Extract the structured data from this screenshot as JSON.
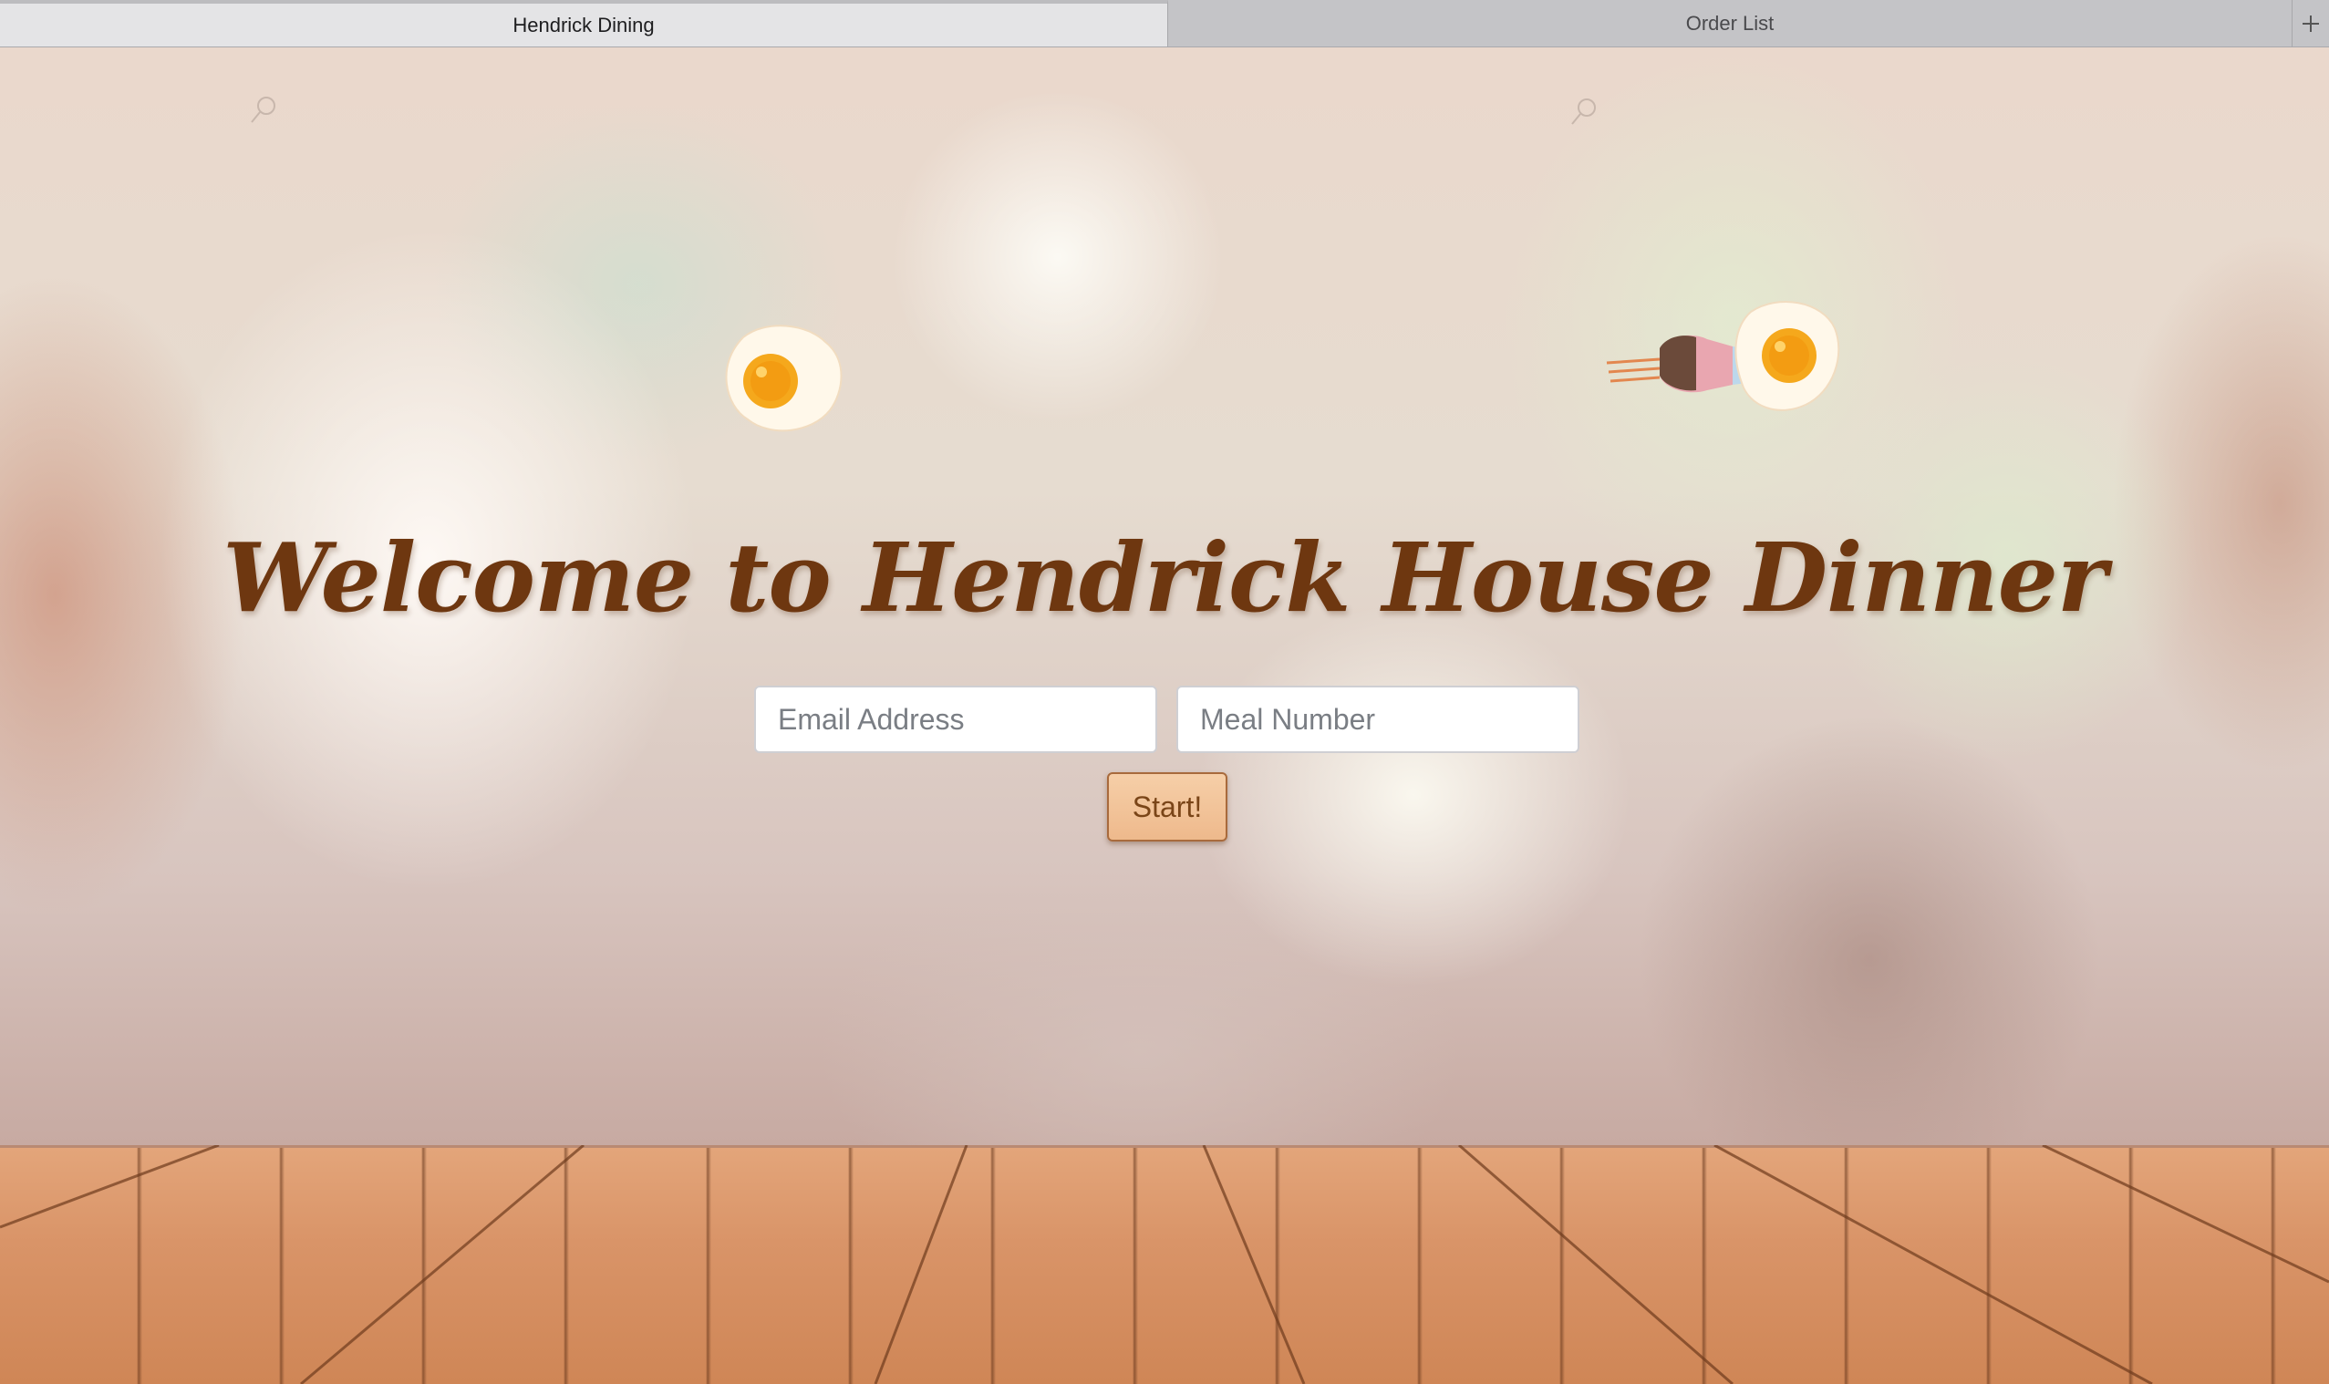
{
  "browser": {
    "tabs": [
      {
        "label": "Hendrick Dining",
        "active": true
      },
      {
        "label": "Order List",
        "active": false
      }
    ],
    "new_tab_icon": "plus-icon"
  },
  "page": {
    "title": "Welcome to Hendrick House Dinner",
    "email": {
      "placeholder": "Email Address",
      "value": ""
    },
    "meal": {
      "placeholder": "Meal Number",
      "value": ""
    },
    "start_label": "Start!",
    "decorations": [
      "fried-egg-icon",
      "rocket-egg-icon",
      "pin-icon"
    ],
    "colors": {
      "title": "#6e3710",
      "button_bg": "#f0bd90",
      "button_border": "#a86a3c",
      "floor": "#d99468"
    }
  }
}
